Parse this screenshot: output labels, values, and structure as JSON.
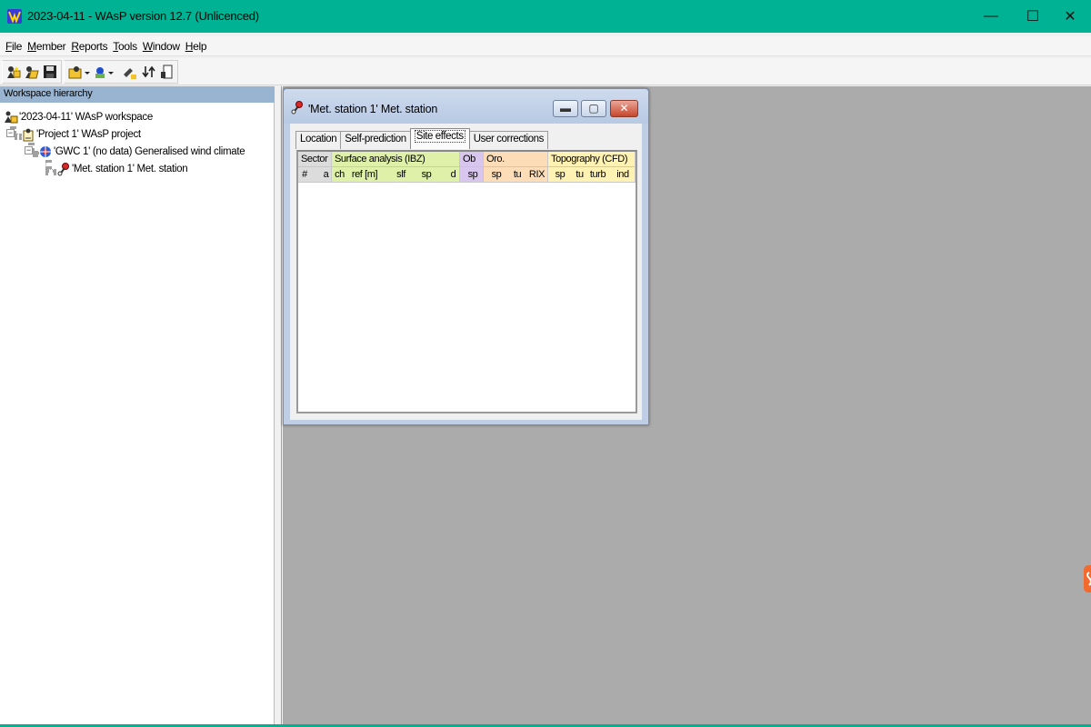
{
  "window": {
    "title": "2023-04-11 - WAsP version 12.7  (Unlicenced)",
    "controls": {
      "minimize": "—",
      "maximize": "☐",
      "close": "✕"
    },
    "accent_color": "#00b294"
  },
  "menu": [
    {
      "mnemonic": "F",
      "rest": "ile"
    },
    {
      "mnemonic": "M",
      "rest": "ember"
    },
    {
      "mnemonic": "R",
      "rest": "eports"
    },
    {
      "mnemonic": "T",
      "rest": "ools"
    },
    {
      "mnemonic": "W",
      "rest": "indow"
    },
    {
      "mnemonic": "H",
      "rest": "elp"
    }
  ],
  "toolbar": {
    "icons": [
      "new-workspace-icon",
      "open-workspace-icon",
      "save-icon",
      "open-project-dropdown-icon",
      "insert-dropdown-icon",
      "edit-icon",
      "sort-icon",
      "document-icon"
    ]
  },
  "workspace": {
    "header": "Workspace hierarchy",
    "tree": [
      {
        "label": "'2023-04-11' WAsP workspace",
        "icon": "workspace-icon"
      },
      {
        "label": "'Project 1' WAsP project",
        "icon": "project-icon"
      },
      {
        "label": "'GWC 1' (no data) Generalised wind climate",
        "icon": "wind-climate-icon"
      },
      {
        "label": "'Met. station 1' Met. station",
        "icon": "met-station-icon"
      }
    ]
  },
  "child_window": {
    "title": "'Met. station 1' Met. station",
    "tabs": [
      {
        "label": "Location"
      },
      {
        "label": "Self-prediction"
      },
      {
        "label": "Site effects",
        "active": true
      },
      {
        "label": "User corrections"
      }
    ],
    "grid": {
      "groups": [
        {
          "label": "Sector",
          "color": "#dcdcdc"
        },
        {
          "label": "Surface analysis (IBZ)",
          "color": "#dff0a8"
        },
        {
          "label": "Ob",
          "color": "#d9c6ee"
        },
        {
          "label": "Oro.",
          "color": "#fcddb8"
        },
        {
          "label": "Topography (CFD)",
          "color": "#fff2b3"
        }
      ],
      "subheaders": {
        "sector": [
          "#",
          "a"
        ],
        "surface": [
          "ch",
          "ref [m]",
          "slf",
          "sp",
          "d"
        ],
        "ob": [
          "sp"
        ],
        "oro": [
          "sp",
          "tu",
          "RIX"
        ],
        "topo": [
          "sp",
          "tu",
          "turb",
          "ind"
        ]
      }
    }
  }
}
